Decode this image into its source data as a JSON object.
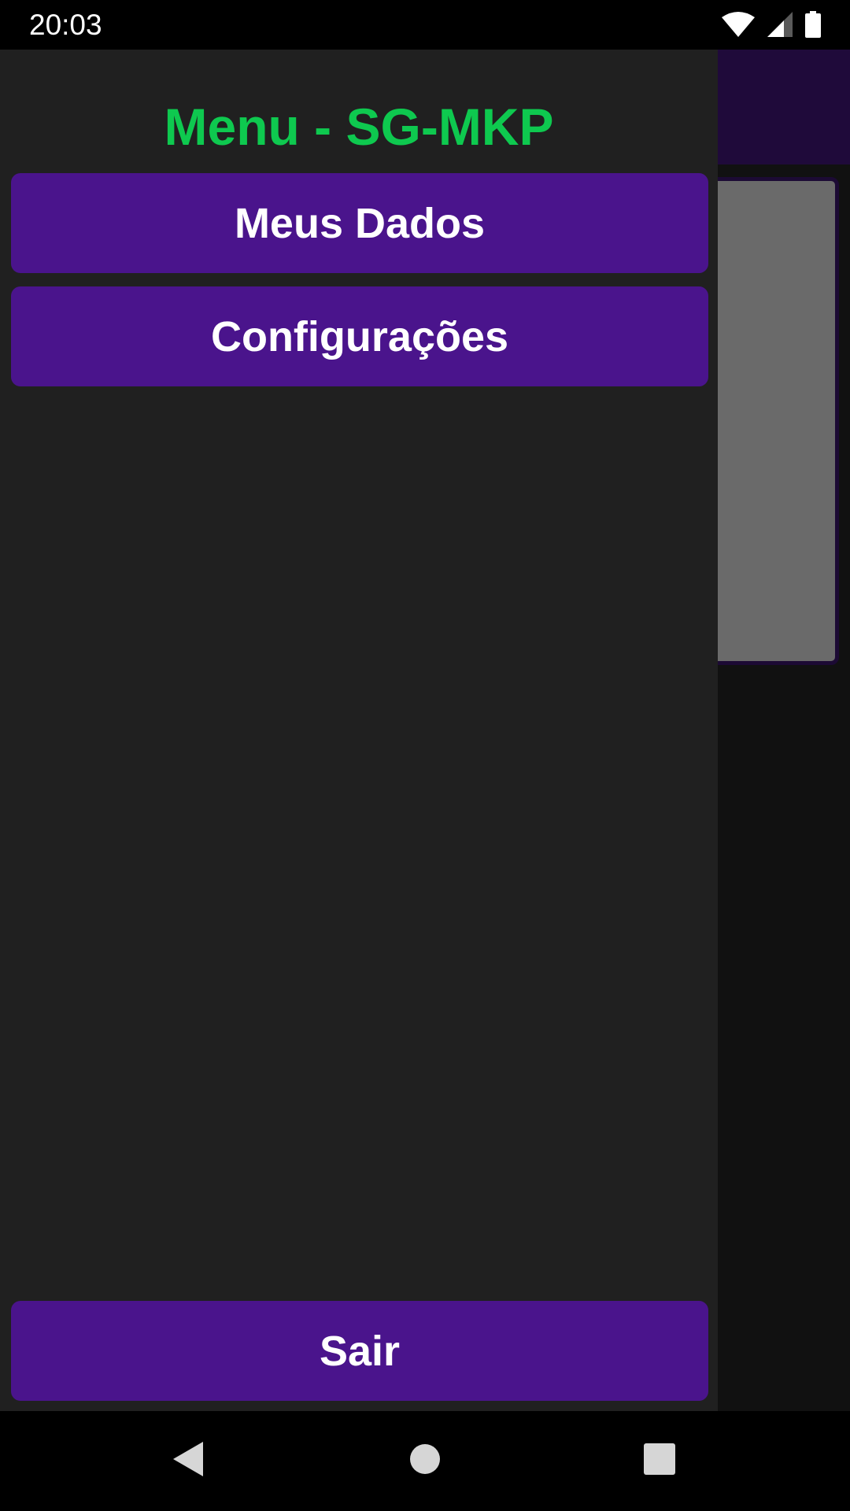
{
  "status_bar": {
    "time": "20:03",
    "icons": [
      "wifi-icon",
      "cellular-signal-icon",
      "battery-icon"
    ]
  },
  "drawer": {
    "title": "Menu - SG-MKP",
    "items": [
      {
        "label": "Meus Dados"
      },
      {
        "label": "Configurações"
      }
    ],
    "logout_label": "Sair"
  },
  "nav_bar": {
    "icons": [
      "back-icon",
      "home-icon",
      "recents-icon"
    ]
  },
  "colors": {
    "title_green": "#0ec94f",
    "button_purple": "#4a148c",
    "drawer_bg": "#202020",
    "toolbar_bg": "#1f0a3a"
  }
}
